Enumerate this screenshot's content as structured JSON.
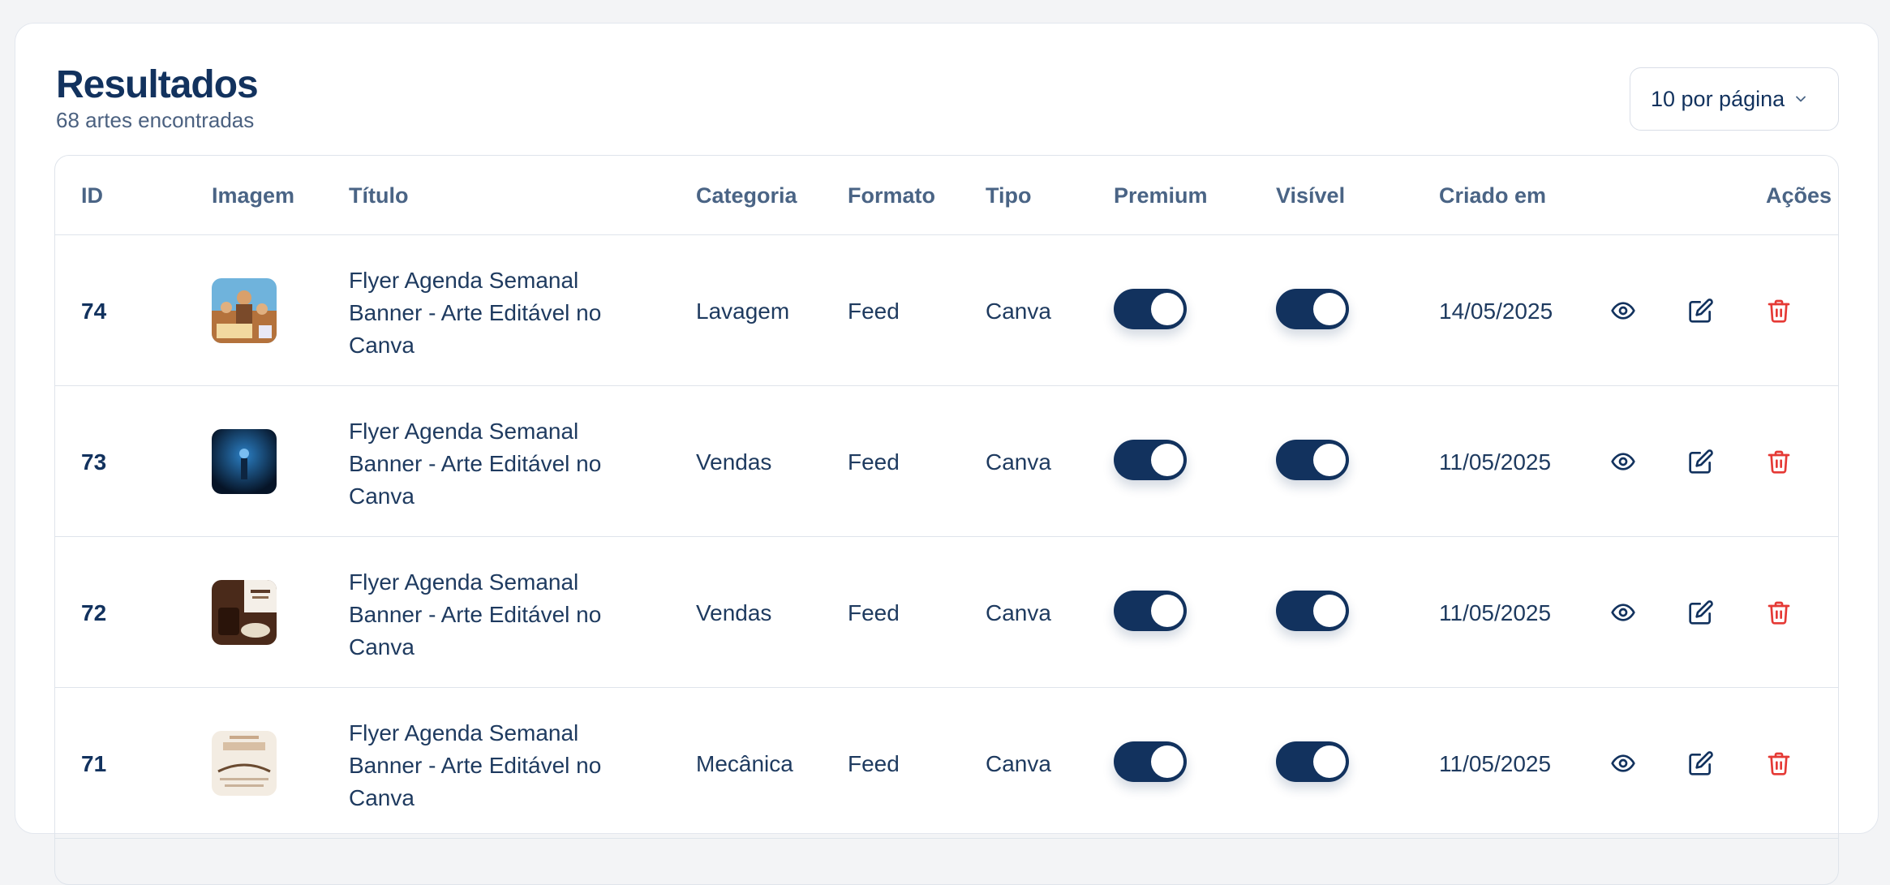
{
  "header": {
    "title": "Resultados",
    "subtitle": "68 artes encontradas",
    "per_page": "10 por página"
  },
  "columns": {
    "id": "ID",
    "image": "Imagem",
    "title": "Título",
    "category": "Categoria",
    "format": "Formato",
    "type": "Tipo",
    "premium": "Premium",
    "visible": "Visível",
    "created": "Criado em",
    "actions": "Ações"
  },
  "rows": [
    {
      "id": "74",
      "thumb": "people-group",
      "title": "Flyer Agenda Semanal Banner - Arte Editável no Canva",
      "category": "Lavagem",
      "format": "Feed",
      "type": "Canva",
      "premium": true,
      "visible": true,
      "created": "14/05/2025"
    },
    {
      "id": "73",
      "thumb": "blue-night",
      "title": "Flyer Agenda Semanal Banner - Arte Editável no Canva",
      "category": "Vendas",
      "format": "Feed",
      "type": "Canva",
      "premium": true,
      "visible": true,
      "created": "11/05/2025"
    },
    {
      "id": "72",
      "thumb": "coffee-bread",
      "title": "Flyer Agenda Semanal Banner - Arte Editável no Canva",
      "category": "Vendas",
      "format": "Feed",
      "type": "Canva",
      "premium": true,
      "visible": true,
      "created": "11/05/2025"
    },
    {
      "id": "71",
      "thumb": "easter-card",
      "title": "Flyer Agenda Semanal Banner - Arte Editável no Canva",
      "category": "Mecânica",
      "format": "Feed",
      "type": "Canva",
      "premium": true,
      "visible": true,
      "created": "11/05/2025"
    }
  ],
  "colors": {
    "primary": "#12325e",
    "danger": "#e53935",
    "background": "#f3f4f6"
  },
  "icons": {
    "view": "eye-icon",
    "edit": "edit-icon",
    "delete": "trash-icon",
    "dropdown": "chevron-down-icon"
  }
}
